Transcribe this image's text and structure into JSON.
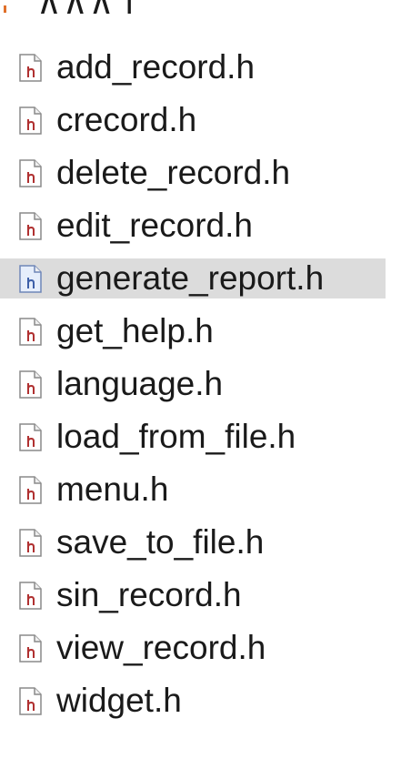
{
  "tree": {
    "partial_item_label": "∧∧∧ i",
    "items": [
      {
        "label": "add_record.h",
        "icon": "header-file-icon",
        "selected": false
      },
      {
        "label": "crecord.h",
        "icon": "header-file-icon",
        "selected": false
      },
      {
        "label": "delete_record.h",
        "icon": "header-file-icon",
        "selected": false
      },
      {
        "label": "edit_record.h",
        "icon": "header-file-icon",
        "selected": false
      },
      {
        "label": "generate_report.h",
        "icon": "header-file-icon",
        "selected": true
      },
      {
        "label": "get_help.h",
        "icon": "header-file-icon",
        "selected": false
      },
      {
        "label": "language.h",
        "icon": "header-file-icon",
        "selected": false
      },
      {
        "label": "load_from_file.h",
        "icon": "header-file-icon",
        "selected": false
      },
      {
        "label": "menu.h",
        "icon": "header-file-icon",
        "selected": false
      },
      {
        "label": "save_to_file.h",
        "icon": "header-file-icon",
        "selected": false
      },
      {
        "label": "sin_record.h",
        "icon": "header-file-icon",
        "selected": false
      },
      {
        "label": "view_record.h",
        "icon": "header-file-icon",
        "selected": false
      },
      {
        "label": "widget.h",
        "icon": "header-file-icon",
        "selected": false
      }
    ]
  },
  "colors": {
    "selection_bg": "#dcdcdc",
    "icon_letter": "#b03030",
    "icon_letter_selected": "#3d5fa8",
    "text": "#1a1a1a"
  }
}
